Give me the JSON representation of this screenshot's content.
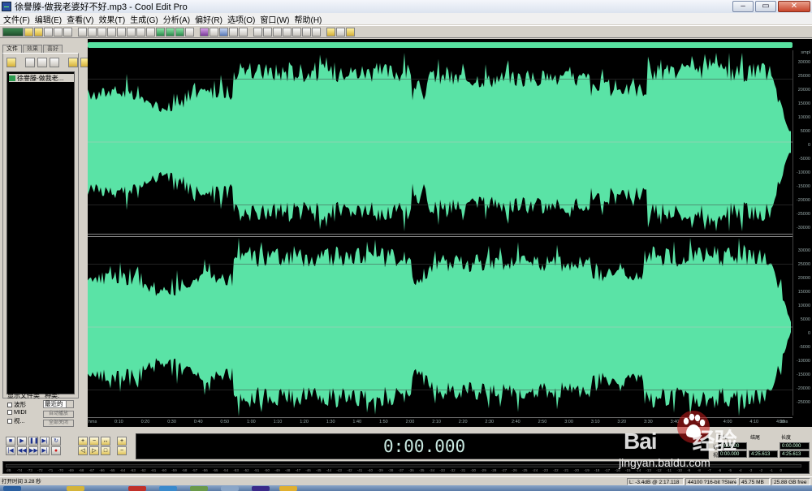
{
  "window": {
    "title": "徐譽滕-做我老婆好不好.mp3 - Cool Edit Pro",
    "controls": [
      "–",
      "▭",
      "✕"
    ]
  },
  "menu": [
    "文件(F)",
    "编辑(E)",
    "查看(V)",
    "效果(T)",
    "生成(G)",
    "分析(A)",
    "偏好(R)",
    "选项(O)",
    "窗口(W)",
    "帮助(H)"
  ],
  "left_panel": {
    "tabs": [
      "文件",
      "效果",
      "喜好"
    ],
    "files": [
      "徐譽滕-做我老..."
    ],
    "filetype_label": "显示文件类",
    "filetype_items": [
      "波形",
      "MIDI",
      "视..."
    ],
    "sort_label": "种类:",
    "sort_value": "最近的",
    "btn1": "自动播放",
    "btn2": "全部关闭"
  },
  "y_scale": {
    "unit": "smpl",
    "top": [
      "30000",
      "25000",
      "20000",
      "15000",
      "10000",
      "5000",
      "0",
      "-5000",
      "-10000",
      "-15000",
      "-20000",
      "-25000",
      "-30000"
    ],
    "bottom": [
      "30000",
      "25000",
      "20000",
      "15000",
      "10000",
      "5000",
      "0",
      "-5000",
      "-10000",
      "-15000",
      "-20000",
      "-25000"
    ]
  },
  "time_ruler": {
    "labels": [
      "hms",
      "0:10",
      "0:20",
      "0:30",
      "0:40",
      "0:50",
      "1:00",
      "1:10",
      "1:20",
      "1:30",
      "1:40",
      "1:50",
      "2:00",
      "2:10",
      "2:20",
      "2:30",
      "2:40",
      "2:50",
      "3:00",
      "3:10",
      "3:20",
      "3:30",
      "3:40",
      "3:50",
      "4:00",
      "4:10",
      "4:20",
      "hms"
    ]
  },
  "time_display": "0:00.000",
  "selection": {
    "header_begin": "开始",
    "header_end": "结尾",
    "header_length": "长度",
    "sel_label": "选",
    "view_label": "视",
    "sel_begin": "0:00.000",
    "sel_length": "0:00.000",
    "view_begin": "0:00.000",
    "view_end": "4:25.613",
    "view_length": "4:25.613"
  },
  "meter_ticks": [
    "dB",
    "-74",
    "-73",
    "-72",
    "-71",
    "-70",
    "-69",
    "-68",
    "-67",
    "-66",
    "-65",
    "-64",
    "-63",
    "-62",
    "-61",
    "-60",
    "-59",
    "-58",
    "-57",
    "-56",
    "-55",
    "-54",
    "-53",
    "-52",
    "-51",
    "-50",
    "-49",
    "-48",
    "-47",
    "-46",
    "-45",
    "-44",
    "-43",
    "-42",
    "-41",
    "-40",
    "-39",
    "-38",
    "-37",
    "-36",
    "-35",
    "-34",
    "-33",
    "-32",
    "-31",
    "-30",
    "-29",
    "-28",
    "-27",
    "-26",
    "-25",
    "-24",
    "-23",
    "-22",
    "-21",
    "-20",
    "-19",
    "-18",
    "-17",
    "-16",
    "-15",
    "-14",
    "-13",
    "-12",
    "-11",
    "-10",
    "-9",
    "-8",
    "-7",
    "-6",
    "-5",
    "-4",
    "-3",
    "-2",
    "-1",
    "0"
  ],
  "status": {
    "message": "打开时间 3.28 秒",
    "level": "L: -3.4dB @  2:17.118",
    "format": "44100 ?16-bit ?Stereo",
    "size": "45.75 MB",
    "free": "25.88 GB free"
  },
  "watermark": {
    "brand": "Bai",
    "brand2": "经验",
    "url": "jingyan.baidu.com"
  },
  "colors": {
    "waveform": "#5ae3a6",
    "background": "#000000",
    "chrome": "#d4d0c8"
  }
}
